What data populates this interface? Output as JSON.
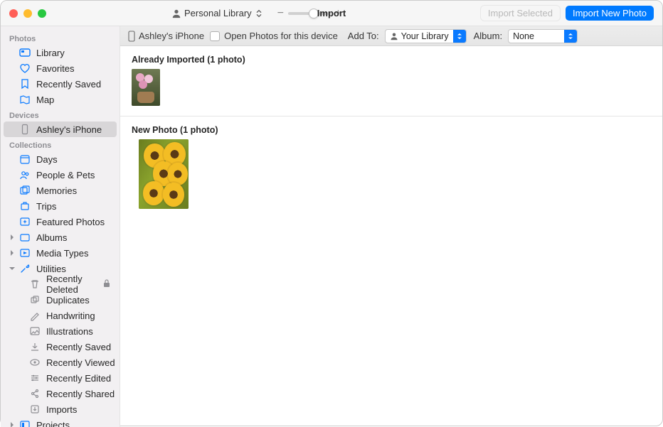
{
  "titlebar": {
    "library_selector": "Personal Library",
    "title": "Import",
    "import_selected": "Import Selected",
    "import_new": "Import New Photo"
  },
  "subbar": {
    "device_name": "Ashley's iPhone",
    "open_photos_label": "Open Photos for this device",
    "add_to_label": "Add To:",
    "add_to_value": "Your Library",
    "album_label": "Album:",
    "album_value": "None"
  },
  "sidebar": {
    "sections": {
      "photos": "Photos",
      "devices": "Devices",
      "collections": "Collections"
    },
    "library": "Library",
    "favorites": "Favorites",
    "recently_saved": "Recently Saved",
    "map": "Map",
    "ashleys_iphone": "Ashley's iPhone",
    "days": "Days",
    "people_pets": "People & Pets",
    "memories": "Memories",
    "trips": "Trips",
    "featured_photos": "Featured Photos",
    "albums": "Albums",
    "media_types": "Media Types",
    "utilities": "Utilities",
    "recently_deleted": "Recently Deleted",
    "duplicates": "Duplicates",
    "handwriting": "Handwriting",
    "illustrations": "Illustrations",
    "recently_saved2": "Recently Saved",
    "recently_viewed": "Recently Viewed",
    "recently_edited": "Recently Edited",
    "recently_shared": "Recently Shared",
    "imports": "Imports",
    "projects": "Projects"
  },
  "content": {
    "already_imported_header": "Already Imported (1 photo)",
    "new_photo_header": "New Photo (1 photo)"
  }
}
